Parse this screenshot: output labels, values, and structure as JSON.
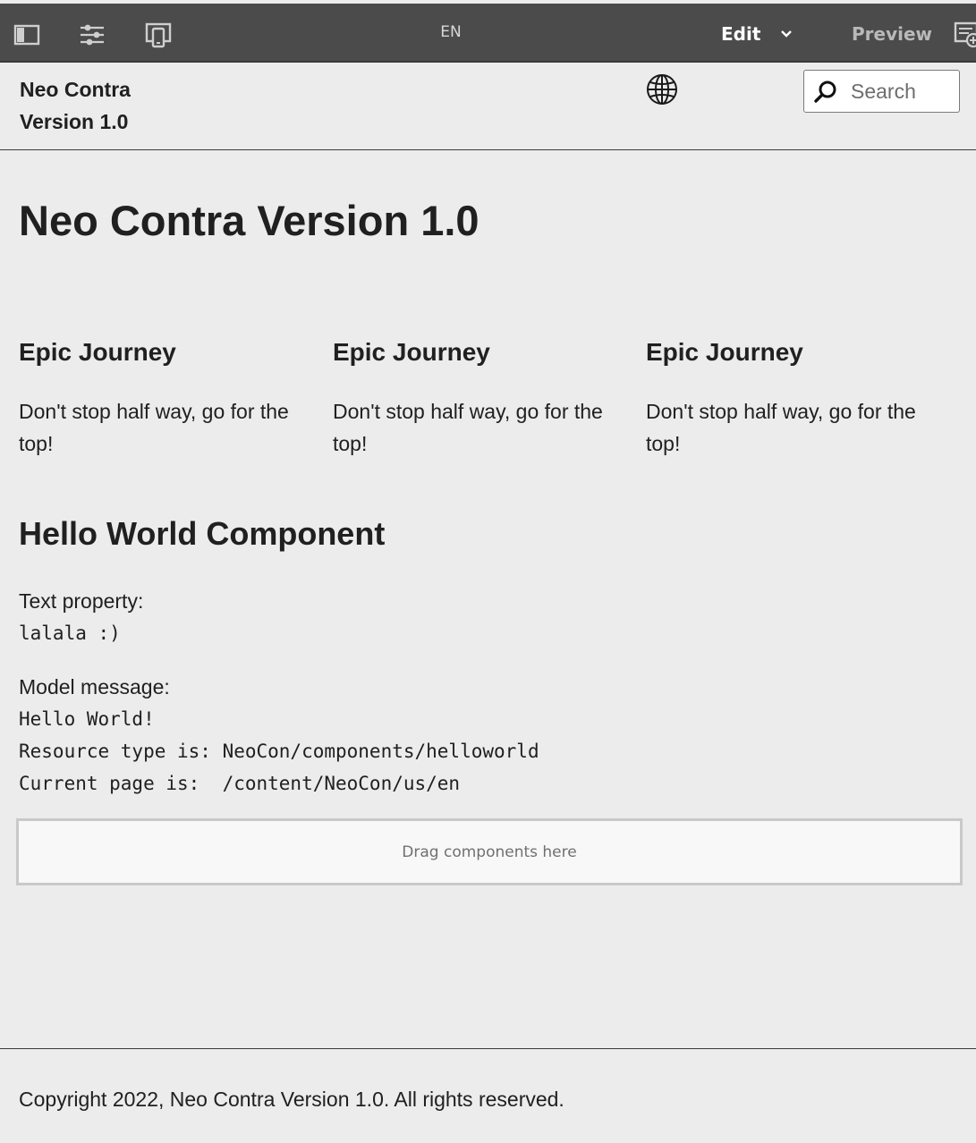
{
  "toolbar": {
    "icons": [
      "side-panel-icon",
      "page-properties-icon",
      "emulator-icon",
      "annotations-icon"
    ],
    "language": "EN",
    "mode_label": "Edit",
    "preview_label": "Preview",
    "colors": {
      "background": "#4b4b4b",
      "active_text": "#ffffff",
      "inactive_text": "#b9b9b9"
    }
  },
  "header": {
    "site_title_line1": "Neo Contra",
    "site_title_line2": "Version 1.0",
    "search_placeholder": "Search"
  },
  "main": {
    "page_title": "Neo Contra Version 1.0",
    "teasers": [
      {
        "title": "Epic Journey",
        "text": "Don't stop half way, go for the top!"
      },
      {
        "title": "Epic Journey",
        "text": "Don't stop half way, go for the top!"
      },
      {
        "title": "Epic Journey",
        "text": "Don't stop half way, go for the top!"
      }
    ],
    "hello_world": {
      "title": "Hello World Component",
      "text_property_label": "Text property:",
      "text_property_value": "lalala :)",
      "model_message_label": "Model message:",
      "model_lines": [
        "Hello World!",
        "Resource type is: NeoCon/components/helloworld",
        "Current page is:  /content/NeoCon/us/en"
      ]
    },
    "dropzone_label": "Drag components here"
  },
  "footer": {
    "copyright": "Copyright 2022, Neo Contra Version 1.0. All rights reserved."
  }
}
